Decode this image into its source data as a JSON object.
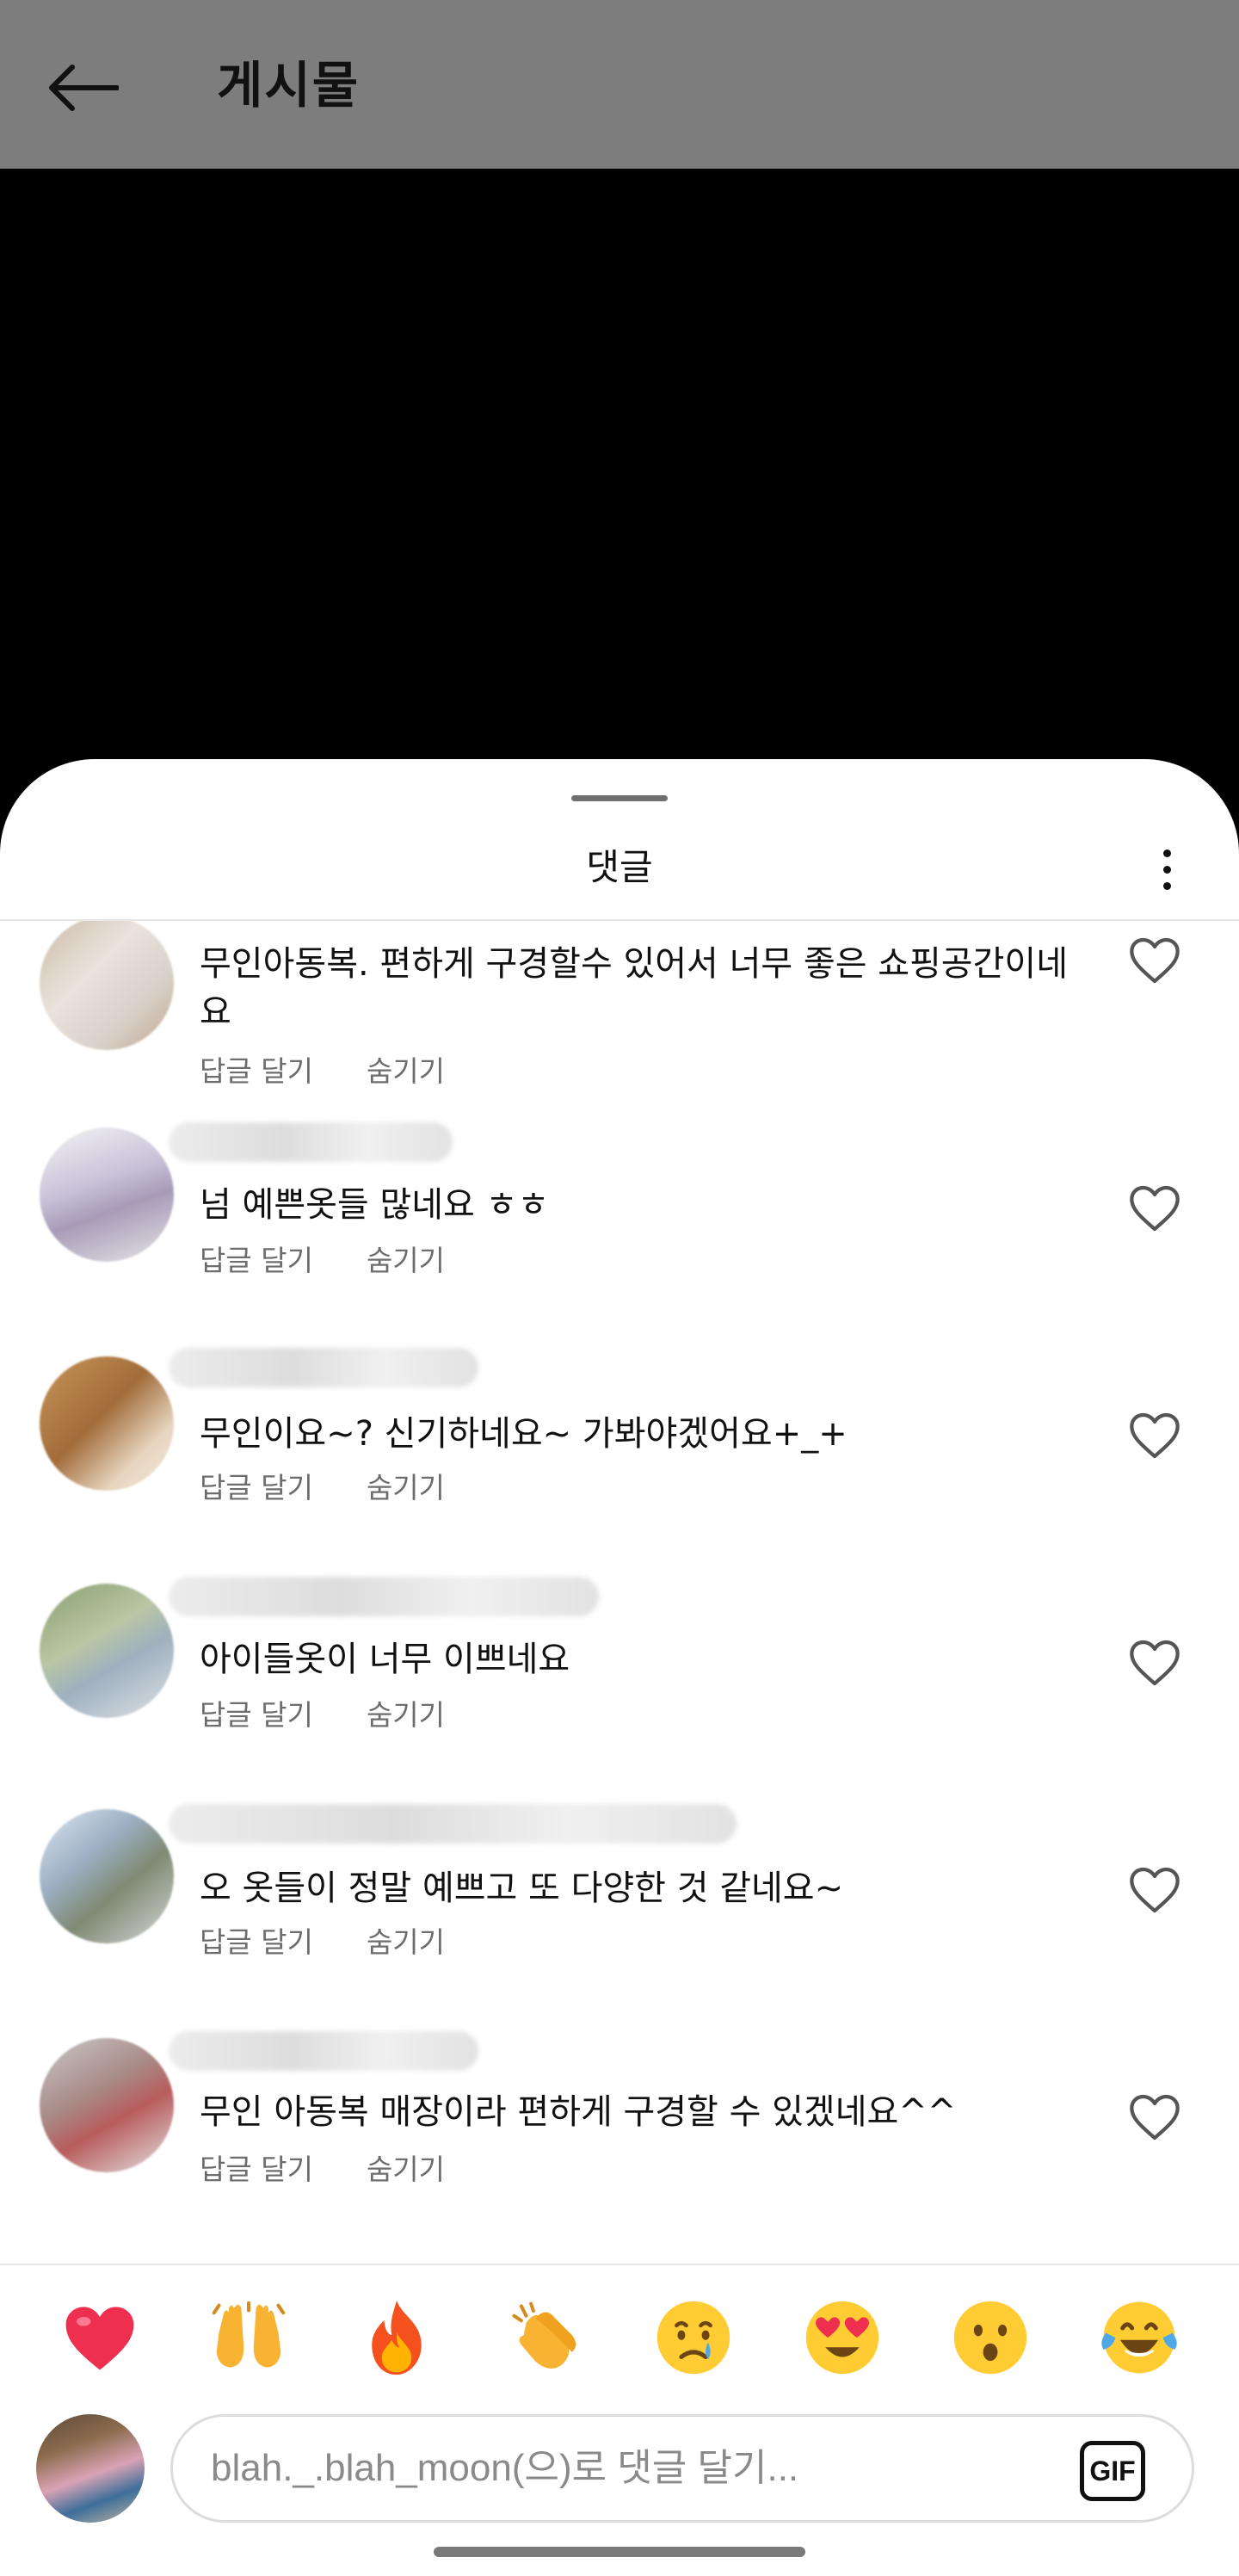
{
  "header": {
    "title": "게시물",
    "back_icon": "arrow-left-icon"
  },
  "sheet": {
    "title": "댓글",
    "more_icon": "more-vertical-icon"
  },
  "comments": [
    {
      "text": "무인아동복. 편하게 구경할수 있어서 너무 좋은 쇼핑공간이네요",
      "reply_label": "답글 달기",
      "hide_label": "숨기기"
    },
    {
      "text": "넘 예쁜옷들 많네요 ㅎㅎ",
      "reply_label": "답글 달기",
      "hide_label": "숨기기"
    },
    {
      "text": "무인이요~? 신기하네요~ 가봐야겠어요+_+",
      "reply_label": "답글 달기",
      "hide_label": "숨기기"
    },
    {
      "text": "아이들옷이 너무 이쁘네요",
      "reply_label": "답글 달기",
      "hide_label": "숨기기"
    },
    {
      "text": "오 옷들이 정말 예쁘고 또 다양한 것 같네요~",
      "reply_label": "답글 달기",
      "hide_label": "숨기기"
    },
    {
      "text": "무인 아동복 매장이라 편하게 구경할 수 있겠네요^^",
      "reply_label": "답글 달기",
      "hide_label": "숨기기"
    }
  ],
  "reactions": [
    "red-heart-emoji",
    "raising-hands-emoji",
    "fire-emoji",
    "clapping-hands-emoji",
    "crying-face-emoji",
    "heart-eyes-emoji",
    "surprised-face-emoji",
    "tears-of-joy-emoji"
  ],
  "composer": {
    "placeholder": "blah._.blah_moon(으)로 댓글 달기...",
    "gif_label": "GIF"
  },
  "colors": {
    "header_bg": "#7d7d7d",
    "video_bg": "#000000",
    "heart_red": "#ee2f4f",
    "secondary_text": "#6d6d6d"
  }
}
